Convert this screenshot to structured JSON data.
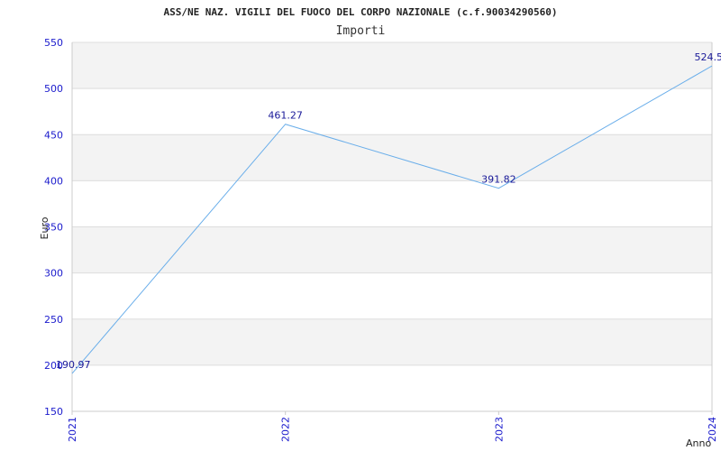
{
  "chart_data": {
    "type": "line",
    "title": "ASS/NE NAZ. VIGILI DEL FUOCO DEL CORPO NAZIONALE (c.f.90034290560)",
    "subtitle": "Importi",
    "xlabel": "Anno",
    "ylabel": "Euro",
    "ylim": [
      150,
      550
    ],
    "yticks": [
      150,
      200,
      250,
      300,
      350,
      400,
      450,
      500,
      550
    ],
    "categories": [
      "2021",
      "2022",
      "2023",
      "2024"
    ],
    "series": [
      {
        "values": [
          190.97,
          461.27,
          391.82,
          524.5
        ]
      }
    ],
    "data_labels": [
      "190.97",
      "461.27",
      "391.82",
      "524.5"
    ],
    "grid": true,
    "colors": {
      "line": "#6aaeea",
      "band": "#f3f3f3",
      "grid": "#dddddd",
      "tick_text": "#1a1acc"
    }
  }
}
